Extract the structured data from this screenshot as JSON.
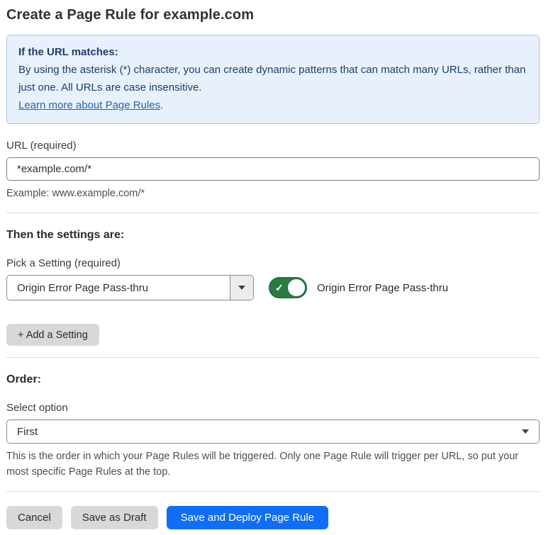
{
  "page": {
    "title": "Create a Page Rule for example.com"
  },
  "info_box": {
    "heading": "If the URL matches:",
    "body": "By using the asterisk (*) character, you can create dynamic patterns that can match many URLs, rather than just one. All URLs are case insensitive.",
    "link_label": "Learn more about Page Rules",
    "link_suffix": "."
  },
  "url_section": {
    "label": "URL (required)",
    "input_value": "*example.com/*",
    "helper": "Example: www.example.com/*"
  },
  "settings_section": {
    "heading": "Then the settings are:",
    "picker_label": "Pick a Setting (required)",
    "picker_value": "Origin Error Page Pass-thru",
    "toggle_state": "on",
    "toggle_check": "✓",
    "toggle_label": "Origin Error Page Pass-thru",
    "add_setting_label": "+ Add a Setting"
  },
  "order_section": {
    "heading": "Order:",
    "select_label": "Select option",
    "select_value": "First",
    "helper": "This is the order in which your Page Rules will be triggered. Only one Page Rule will trigger per URL, so put your most specific Page Rules at the top."
  },
  "footer": {
    "cancel_label": "Cancel",
    "save_draft_label": "Save as Draft",
    "save_deploy_label": "Save and Deploy Page Rule"
  },
  "colors": {
    "info_bg": "#e8f1fb",
    "info_border": "#a9c7e8",
    "info_text": "#1d3c6e",
    "link": "#2563b0",
    "toggle_on_green": "#2c7b40",
    "primary_button_blue": "#0f6ef5",
    "secondary_button_gray": "#d8d8d8"
  }
}
